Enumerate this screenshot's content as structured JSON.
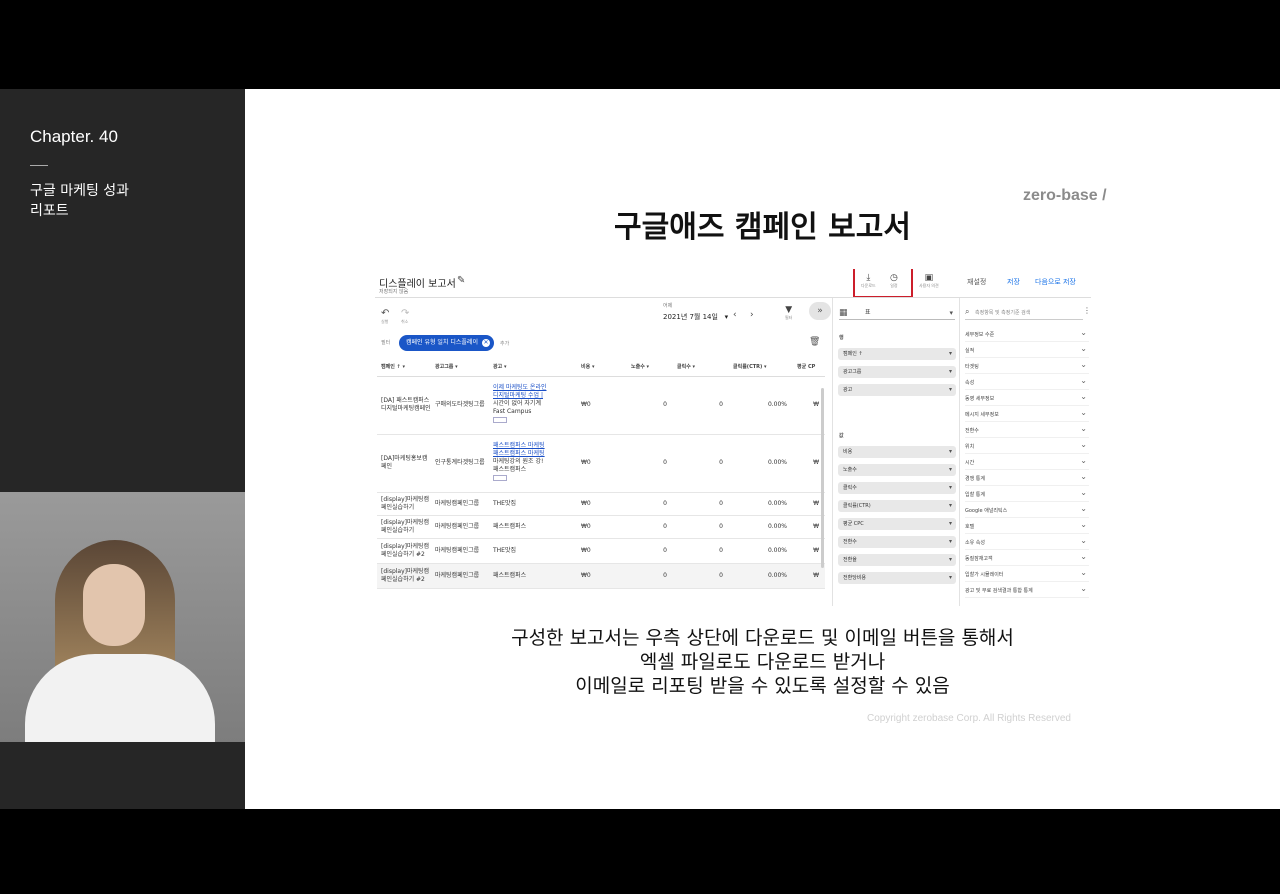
{
  "sidebar": {
    "chapter": "Chapter. 40",
    "subtitle_line1": "구글 마케팅 성과",
    "subtitle_line2": "리포트"
  },
  "slide": {
    "brand": "zero-base /",
    "title": "구글애즈 캠페인 보고서",
    "caption_line1": "구성한 보고서는 우측 상단에 다운로드 및 이메일 버튼을 통해서",
    "caption_line2": "엑셀 파일로도 다운로드 받거나",
    "caption_line3": "이메일로 리포팅 받을 수 있도록 설정할 수 있음",
    "copyright": "Copyright zerobase Corp. All Rights Reserved",
    "accent_color": "#cc1e2b"
  },
  "report": {
    "title": "디스플레이 보고서",
    "subtitle": "저장되지 않음",
    "toolbar": {
      "download_label": "다운로드",
      "schedule_label": "일정",
      "feedback_label": "사용자 의견",
      "reset_label": "재설정",
      "save_label": "저장",
      "save_as_label": "다음으로 저장"
    },
    "undo_label": "실행",
    "redo_label": "취소",
    "date_label": "어제",
    "date_value": "2021년 7월 14일",
    "filter_label": "필터",
    "filter_row_label": "필터",
    "filter_chip": "캠페인 유형 일치 디스플레이",
    "add_label": "추가",
    "columns": [
      "캠페인 ↑ ▾",
      "광고그룹 ▾",
      "광고 ▾",
      "비용 ▾",
      "노출수 ▾",
      "클릭수 ▾",
      "클릭률(CTR) ▾",
      "평균 CP"
    ],
    "rows": [
      {
        "campaign": "[DA] 패스트캠퍼스디지털마케팅캠페인",
        "adgroup": "구매의도타겟팅그룹",
        "ad_link1": "이제 마케팅도 온라인",
        "ad_link2": "디지털마케팅 수업 |",
        "ad_text1": "시간이 없어 자기계",
        "ad_text2": "Fast Campus",
        "cost": "₩0",
        "impr": "0",
        "clicks": "0",
        "ctr": "0.00%",
        "cpc": "₩"
      },
      {
        "campaign": "[DA]마케팅홍보캠페인",
        "adgroup": "인구통계타겟팅그룹",
        "ad_link1": "패스트캠퍼스 마케팅",
        "ad_link2": "패스트캠퍼스 마케팅",
        "ad_text1": "마케팅강의 원조 강!",
        "ad_text2": "패스트캠퍼스",
        "cost": "₩0",
        "impr": "0",
        "clicks": "0",
        "ctr": "0.00%",
        "cpc": "₩"
      },
      {
        "campaign": "[display]마케팅캠페인실습하기",
        "adgroup": "마케팅캠페인그룹",
        "ad_text1": "THE맛집",
        "cost": "₩0",
        "impr": "0",
        "clicks": "0",
        "ctr": "0.00%",
        "cpc": "₩"
      },
      {
        "campaign": "[display]마케팅캠페인실습하기",
        "adgroup": "마케팅캠페인그룹",
        "ad_text1": "패스트캠퍼스",
        "cost": "₩0",
        "impr": "0",
        "clicks": "0",
        "ctr": "0.00%",
        "cpc": "₩"
      },
      {
        "campaign": "[display]마케팅캠페인실습하기 #2",
        "adgroup": "마케팅캠페인그룹",
        "ad_text1": "THE맛집",
        "cost": "₩0",
        "impr": "0",
        "clicks": "0",
        "ctr": "0.00%",
        "cpc": "₩"
      },
      {
        "campaign": "[display]마케팅캠페인실습하기 #2",
        "adgroup": "마케팅캠페인그룹",
        "ad_text1": "패스트캠퍼스",
        "cost": "₩0",
        "impr": "0",
        "clicks": "0",
        "ctr": "0.00%",
        "cpc": "₩"
      }
    ],
    "panel": {
      "view_select": "표",
      "rows_label": "행",
      "row_pills": [
        "캠페인 ↑",
        "광고그룹",
        "광고"
      ],
      "values_label": "값",
      "value_pills": [
        "비용",
        "노출수",
        "클릭수",
        "클릭률(CTR)",
        "평균 CPC",
        "전환수",
        "전환율",
        "전환당비용"
      ]
    },
    "catalog": {
      "search_placeholder": "측정항목 및 측정기준 검색",
      "items": [
        "세부정보 수준",
        "실적",
        "타겟팅",
        "속성",
        "동영 세부정보",
        "메시지 세부정보",
        "전환수",
        "위치",
        "시간",
        "경쟁 통계",
        "입찰 통계",
        "Google 애널리틱스",
        "호텔",
        "소유 속성",
        "동질잠재고객",
        "입찰가 시뮬레이터",
        "광고 및 무료 검색결과 통합 통계"
      ]
    }
  }
}
